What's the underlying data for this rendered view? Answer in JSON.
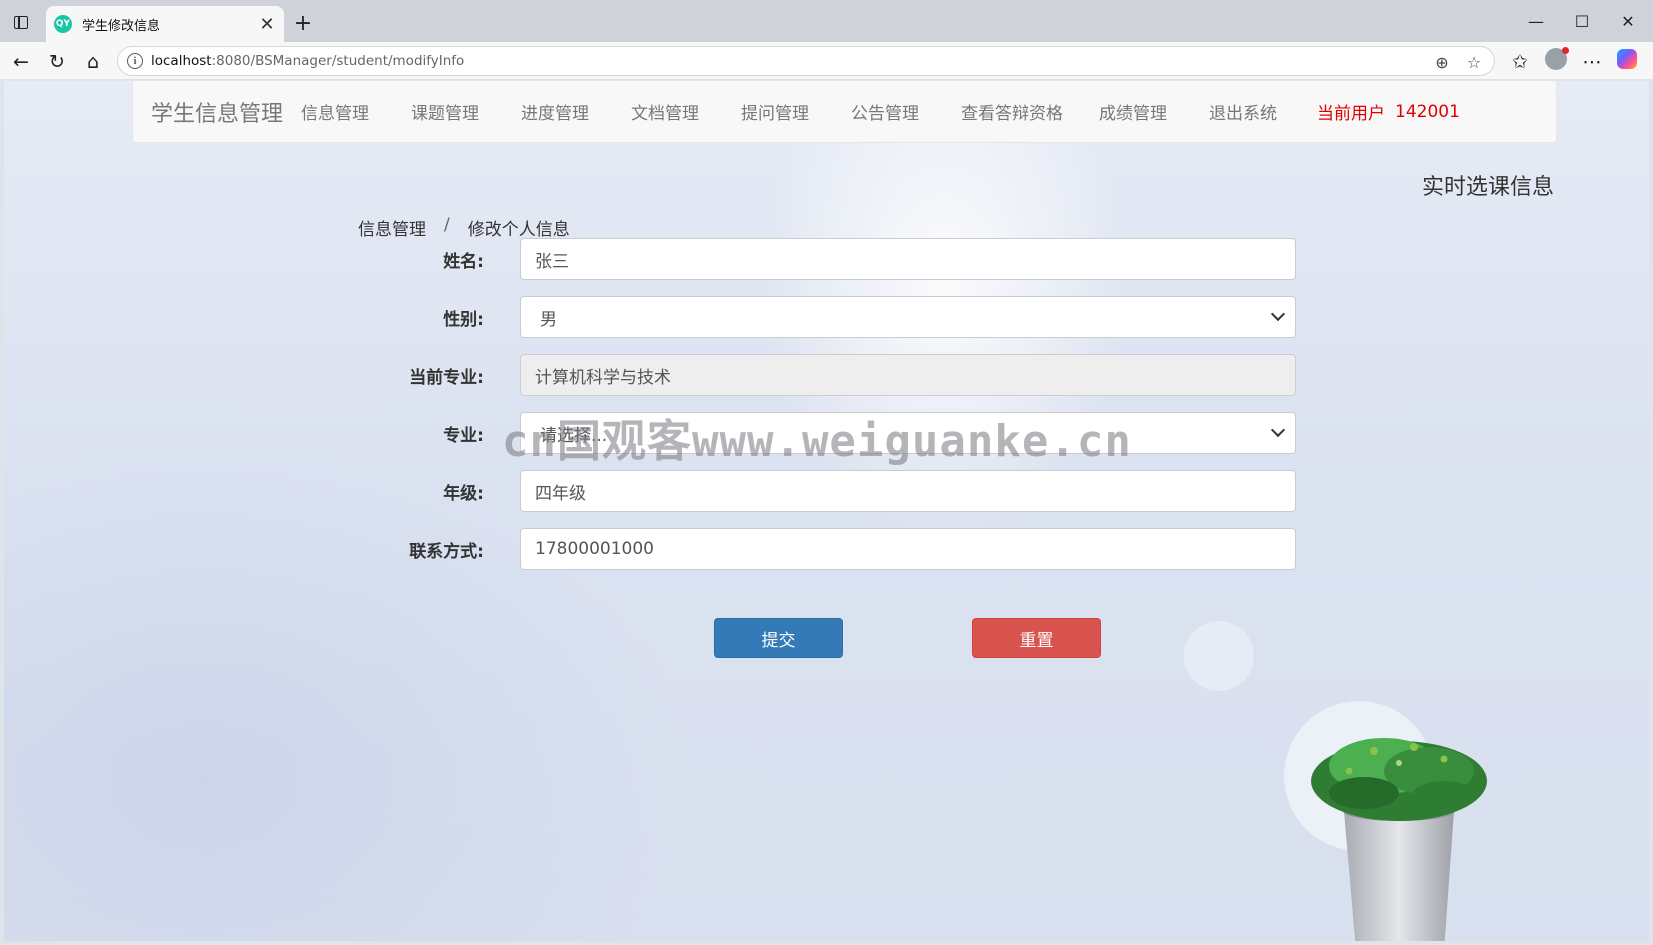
{
  "browser": {
    "tab_title": "学生修改信息",
    "tab_favicon_text": "QY",
    "url_host": "localhost",
    "url_path": ":8080/BSManager/student/modifyInfo"
  },
  "navbar": {
    "brand": "学生信息管理",
    "items": [
      {
        "label": "信息管理"
      },
      {
        "label": "课题管理"
      },
      {
        "label": "进度管理"
      },
      {
        "label": "文档管理"
      },
      {
        "label": "提问管理"
      },
      {
        "label": "公告管理"
      },
      {
        "label": "查看答辩资格"
      },
      {
        "label": "成绩管理"
      },
      {
        "label": "退出系统"
      }
    ],
    "current_user_label": "当前用户",
    "current_user_id": "142001"
  },
  "side_title": "实时选课信息",
  "breadcrumb": {
    "parent": "信息管理",
    "separator": "/",
    "current": "修改个人信息"
  },
  "form": {
    "name": {
      "label": "姓名:",
      "value": "张三"
    },
    "gender": {
      "label": "性别:",
      "value": "男"
    },
    "current_major": {
      "label": "当前专业:",
      "value": "计算机科学与技术"
    },
    "major": {
      "label": "专业:",
      "value": "请选择..."
    },
    "grade": {
      "label": "年级:",
      "value": "四年级"
    },
    "contact": {
      "label": "联系方式:",
      "value": "17800001000"
    }
  },
  "buttons": {
    "submit": "提交",
    "reset": "重置"
  },
  "watermark": "cn国观客www.weiguanke.cn",
  "colors": {
    "primary": "#337ab7",
    "danger": "#d9534f",
    "user_text": "#e00000"
  }
}
